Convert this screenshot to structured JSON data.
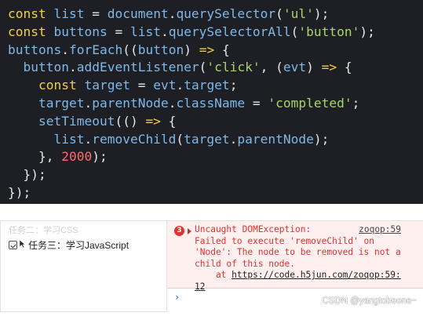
{
  "code": {
    "lines": [
      [
        [
          "kw",
          "const"
        ],
        [
          "op",
          " "
        ],
        [
          "var",
          "list"
        ],
        [
          "op",
          " = "
        ],
        [
          "var",
          "document"
        ],
        [
          "op",
          "."
        ],
        [
          "fn",
          "querySelector"
        ],
        [
          "op",
          "("
        ],
        [
          "str",
          "'ul'"
        ],
        [
          "op",
          ");"
        ]
      ],
      [
        [
          "kw",
          "const"
        ],
        [
          "op",
          " "
        ],
        [
          "var",
          "buttons"
        ],
        [
          "op",
          " = "
        ],
        [
          "var",
          "list"
        ],
        [
          "op",
          "."
        ],
        [
          "fn",
          "querySelectorAll"
        ],
        [
          "op",
          "("
        ],
        [
          "str",
          "'button'"
        ],
        [
          "op",
          ");"
        ]
      ],
      [
        [
          "var",
          "buttons"
        ],
        [
          "op",
          "."
        ],
        [
          "fn",
          "forEach"
        ],
        [
          "op",
          "(("
        ],
        [
          "var",
          "button"
        ],
        [
          "op",
          ") "
        ],
        [
          "kw",
          "=>"
        ],
        [
          "op",
          " {"
        ]
      ],
      [
        [
          "op",
          "  "
        ],
        [
          "var",
          "button"
        ],
        [
          "op",
          "."
        ],
        [
          "fn",
          "addEventListener"
        ],
        [
          "op",
          "("
        ],
        [
          "str",
          "'click'"
        ],
        [
          "op",
          ", ("
        ],
        [
          "var",
          "evt"
        ],
        [
          "op",
          ") "
        ],
        [
          "kw",
          "=>"
        ],
        [
          "op",
          " {"
        ]
      ],
      [
        [
          "op",
          "    "
        ],
        [
          "kw",
          "const"
        ],
        [
          "op",
          " "
        ],
        [
          "var",
          "target"
        ],
        [
          "op",
          " = "
        ],
        [
          "var",
          "evt"
        ],
        [
          "op",
          "."
        ],
        [
          "var",
          "target"
        ],
        [
          "op",
          ";"
        ]
      ],
      [
        [
          "op",
          "    "
        ],
        [
          "var",
          "target"
        ],
        [
          "op",
          "."
        ],
        [
          "var",
          "parentNode"
        ],
        [
          "op",
          "."
        ],
        [
          "var",
          "className"
        ],
        [
          "op",
          " = "
        ],
        [
          "str",
          "'completed'"
        ],
        [
          "op",
          ";"
        ]
      ],
      [
        [
          "op",
          "    "
        ],
        [
          "fn",
          "setTimeout"
        ],
        [
          "op",
          "(() "
        ],
        [
          "kw",
          "=>"
        ],
        [
          "op",
          " {"
        ]
      ],
      [
        [
          "op",
          "      "
        ],
        [
          "var",
          "list"
        ],
        [
          "op",
          "."
        ],
        [
          "fn",
          "removeChild"
        ],
        [
          "op",
          "("
        ],
        [
          "var",
          "target"
        ],
        [
          "op",
          "."
        ],
        [
          "var",
          "parentNode"
        ],
        [
          "op",
          ");"
        ]
      ],
      [
        [
          "op",
          "    }, "
        ],
        [
          "num",
          "2000"
        ],
        [
          "op",
          ");"
        ]
      ],
      [
        [
          "op",
          "  });"
        ]
      ],
      [
        [
          "op",
          "});"
        ]
      ]
    ]
  },
  "preview": {
    "faded_text": "任务二：学习CSS",
    "task_text": "任务三：学习JavaScript"
  },
  "console": {
    "error_count": "3",
    "error_line1": "Uncaught DOMException:",
    "error_source": "zoqop:59",
    "error_line2": "Failed to execute 'removeChild' on",
    "error_line3": "'Node': The node to be removed is not a",
    "error_line4": "child of this node.",
    "error_at": "    at ",
    "error_link": "https://code.h5jun.com/zoqop:59:",
    "error_link_end": "12",
    "prompt": "›"
  },
  "watermark": "CSDN @yangtobeone~",
  "colors": {
    "keyword": "#f4d03f",
    "function": "#7fb8e8",
    "string": "#a8d46a",
    "number": "#ff6a6a",
    "error": "#e0312f"
  }
}
